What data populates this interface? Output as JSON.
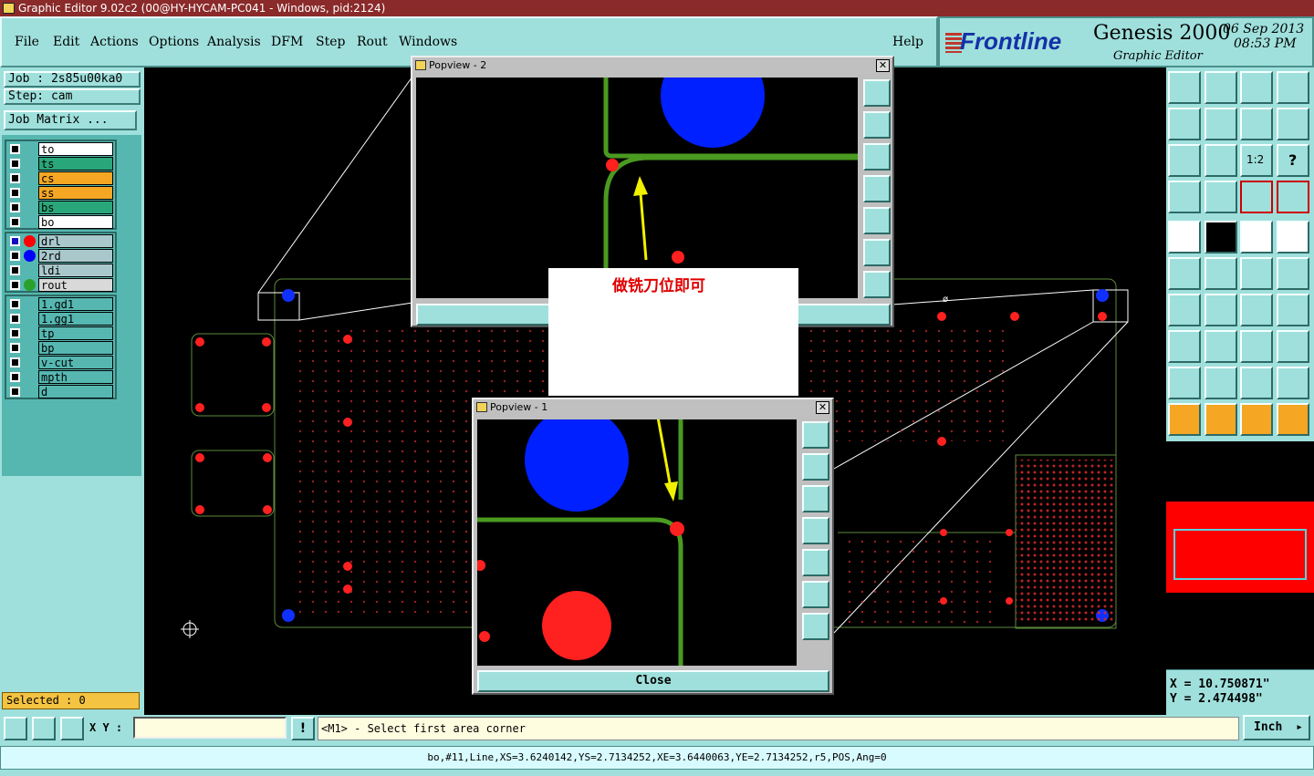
{
  "window_title": "Graphic Editor 9.02c2 (00@HY-HYCAM-PC041 - Windows, pid:2124)",
  "menu": [
    "File",
    "Edit",
    "Actions",
    "Options",
    "Analysis",
    "DFM",
    "Step",
    "Rout",
    "Windows"
  ],
  "help": "Help",
  "logo": {
    "brand": "Frontline",
    "product": "Genesis 2000",
    "subtitle": "Graphic Editor",
    "date": "06 Sep 2013",
    "time": "08:53 PM"
  },
  "job": "Job : 2s85u00ka0",
  "step": "Step: cam",
  "job_matrix": "Job Matrix ...",
  "layers_group1": [
    {
      "name": "to",
      "color": "#ffffff"
    },
    {
      "name": "ts",
      "color": "#2aa77a"
    },
    {
      "name": "cs",
      "color": "#f5a623"
    },
    {
      "name": "ss",
      "color": "#f5a623"
    },
    {
      "name": "bs",
      "color": "#2aa77a"
    },
    {
      "name": "bo",
      "color": "#ffffff"
    }
  ],
  "layers_group2": [
    {
      "name": "drl",
      "dot": "#ff0000"
    },
    {
      "name": "2rd",
      "dot": "#0000ff"
    },
    {
      "name": "ldi",
      "dot": ""
    },
    {
      "name": "rout",
      "dot": "#2aa12a"
    }
  ],
  "layers_group3": [
    "1.gd1",
    "1.gg1",
    "tp",
    "bp",
    "v-cut",
    "mpth",
    "d"
  ],
  "selected": "Selected : 0",
  "popview2_title": "Popview - 2",
  "popview1_title": "Popview - 1",
  "annotation": "做铣刀位即可",
  "close_label": "Close",
  "xy_label": "X Y :",
  "xy_value": "",
  "prompt": "<M1> - Select first area corner",
  "units": "Inch",
  "coord_x": "X =  10.750871\"",
  "coord_y": "Y =  2.474498\"",
  "status": "bo,#11,Line,XS=3.6240142,YS=2.7134252,XE=3.6440063,YE=2.7134252,r5,POS,Ang=0",
  "marker": "ø"
}
